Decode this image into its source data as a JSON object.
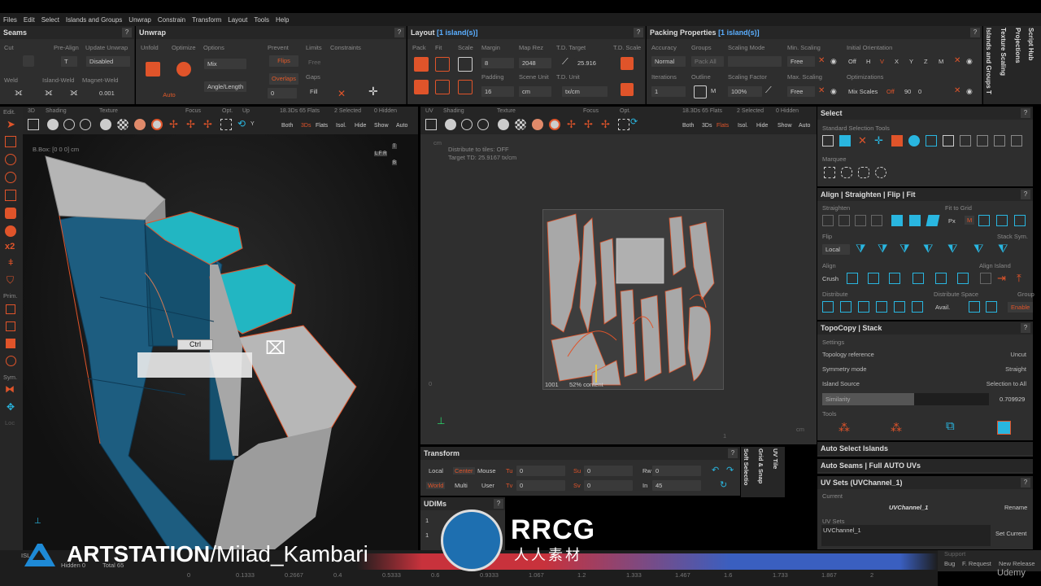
{
  "menu": [
    "Files",
    "Edit",
    "Select",
    "Islands and Groups",
    "Unwrap",
    "Constrain",
    "Transform",
    "Layout",
    "Tools",
    "Help"
  ],
  "seams": {
    "title": "Seams",
    "cut": "Cut",
    "pre_align": "Pre-Align",
    "update_unwrap": "Update Unwrap",
    "update_value": "Disabled",
    "weld": "Weld",
    "island_weld": "Island-Weld",
    "magnet_weld": "Magnet-Weld",
    "magnet_value": "0.001"
  },
  "unwrap": {
    "title": "Unwrap",
    "unfold": "Unfold",
    "optimize": "Optimize",
    "options": "Options",
    "mix": "Mix",
    "angle_length": "Angle/Length",
    "auto": "Auto",
    "prevent": "Prevent",
    "flips": "Flips",
    "overlaps": "Overlaps",
    "limits": "Limits",
    "free": "Free",
    "gaps": "Gaps",
    "fill": "Fill",
    "gaps_value": "0",
    "constraints": "Constraints"
  },
  "layout": {
    "title": "Layout",
    "title_sel": "[1 island(s)]",
    "pack": "Pack",
    "fit": "Fit",
    "scale": "Scale",
    "margin": "Margin",
    "margin_value": "8",
    "map_rez": "Map Rez",
    "map_rez_value": "2048",
    "td_target": "T.D. Target",
    "td_target_value": "25.916",
    "td_scale": "T.D. Scale",
    "padding": "Padding",
    "padding_value": "16",
    "scene_unit": "Scene Unit",
    "scene_unit_value": "cm",
    "td_unit": "T.D. Unit",
    "td_unit_value": "tx/cm"
  },
  "packing": {
    "title": "Packing Properties",
    "title_sel": "[1 island(s)]",
    "accuracy": "Accuracy",
    "accuracy_value": "Normal",
    "groups": "Groups",
    "pack_all": "Pack All",
    "scaling_mode": "Scaling Mode",
    "min_scaling": "Min. Scaling",
    "min_scaling_value": "Free",
    "initial_orientation": "Initial Orientation",
    "orientation_off": "Off",
    "orientation_h": "H",
    "orientation_v": "V",
    "axes": [
      "X",
      "Y",
      "Z",
      "M"
    ],
    "iterations": "Iterations",
    "iterations_value": "1",
    "outline": "Outline",
    "scaling_factor": "Scaling Factor",
    "scaling_factor_value": "100%",
    "max_scaling": "Max. Scaling",
    "max_scaling_value": "Free",
    "optimizations": "Optimizations",
    "mix_scales": "Mix Scales",
    "mix_off": "Off",
    "mix_90": "90",
    "mix_0": "0"
  },
  "side_tabs": [
    "Script Hub",
    "Projections",
    "Texture Scaling",
    "Islands and Groups T"
  ],
  "left_tools": {
    "edit": "Edit.",
    "prim": "Prim.",
    "sym": "Sym.",
    "loc": "Loc"
  },
  "vp3d": {
    "view": "3D",
    "shading": "Shading",
    "texture": "Texture",
    "focus": "Focus",
    "opt": "Opt.",
    "up": "Up",
    "axis": "Y",
    "stats": "18.3Ds 65 Flats",
    "selected": "2 Selected",
    "hidden": "0 Hidden",
    "both": "Both",
    "three_ds": "3Ds",
    "flats": "Flats",
    "isol": "Isol.",
    "hide": "Hide",
    "show": "Show",
    "auto": "Auto",
    "bbox": "B.Box: [0 0 0] cm",
    "ctrl": "Ctrl",
    "cube_top": "T",
    "cube_sides": "L F R",
    "cube_bottom": "B"
  },
  "vpuv": {
    "view": "UV",
    "shading": "Shading",
    "texture": "Texture",
    "focus": "Focus",
    "opt": "Opt.",
    "stats": "18.3Ds 65 Flats",
    "selected": "2 Selected",
    "hidden": "0 Hidden",
    "both": "Both",
    "three_ds": "3Ds",
    "flats": "Flats",
    "isol": "Isol.",
    "hide": "Hide",
    "show": "Show",
    "auto": "Auto",
    "info1": "Distribute to tiles: OFF",
    "info2": "Target TD: 25.9167 tx/cm",
    "cm_top": "cm",
    "cm_right": "cm",
    "tile": "1001",
    "content": "52% content",
    "axis0": "0",
    "axis1": "1"
  },
  "transform": {
    "title": "Transform",
    "local": "Local",
    "center": "Center",
    "mouse": "Mouse",
    "tu": "Tu",
    "tu_value": "0",
    "su": "Su",
    "su_value": "0",
    "rw": "Rw",
    "rw_value": "0",
    "world": "World",
    "multi": "Multi",
    "user": "User",
    "tv": "Tv",
    "tv_value": "0",
    "sv": "Sv",
    "sv_value": "0",
    "in": "In",
    "in_value": "45"
  },
  "uv_side_tabs": [
    "Soft Selectio",
    "Grid & Snap",
    "UV Tile"
  ],
  "udims": {
    "title": "UDIMs",
    "row1": "1",
    "row2": "1"
  },
  "select_panel": {
    "title": "Select",
    "std_tools": "Standard Selection Tools",
    "marquee": "Marquee"
  },
  "align_panel": {
    "title": "Align | Straighten | Flip | Fit",
    "straighten": "Straighten",
    "fit_to_grid": "Fit to Grid",
    "px": "Px",
    "m": "M",
    "flip": "Flip",
    "stack_sym": "Stack Sym.",
    "local": "Local",
    "align": "Align",
    "align_island": "Align Island",
    "crush": "Crush",
    "distribute": "Distribute",
    "distribute_space": "Distribute Space",
    "group": "Group",
    "avail": "Avail.",
    "enable": "Enable"
  },
  "topo_panel": {
    "title": "TopoCopy | Stack",
    "settings": "Settings",
    "topology_reference": "Topology reference",
    "topology_value": "Uncut",
    "symmetry_mode": "Symmetry mode",
    "symmetry_value": "Straight",
    "island_source": "Island Source",
    "island_source_value": "Selection to All",
    "similarity": "Similarity",
    "similarity_value": "0.709929",
    "similarity_level": 0.55,
    "tools": "Tools"
  },
  "auto_select": "Auto Select Islands",
  "auto_seams": "Auto Seams | Full AUTO UVs",
  "uv_sets": {
    "title": "UV Sets (UVChannel_1)",
    "current": "Current",
    "current_value": "UVChannel_1",
    "rename": "Rename",
    "uv_sets_label": "UV Sets",
    "set_value": "UVChannel_1",
    "set_current": "Set Current"
  },
  "support": {
    "label": "Support",
    "bug": "Bug",
    "request": "F. Request",
    "new_release": "New Release"
  },
  "status": {
    "hidden": "Hidden 0",
    "total": "Total 65",
    "isl": "ISL",
    "ruler": [
      "0",
      "0.1333",
      "0.2667",
      "0.4",
      "0.5333",
      "0.6",
      "0.9333",
      "1.067",
      "1.2",
      "1.333",
      "1.467",
      "1.6",
      "1.733",
      "1.867",
      "2"
    ]
  },
  "watermark": {
    "artstation": "ARTSTATION",
    "author": "/Milad_Kambari",
    "rrcg": "RRCG",
    "rrcg_cn": "人人素材",
    "udemy": "Udemy"
  },
  "colors": {
    "accent": "#e0542a",
    "teal": "#2ab4bf",
    "blue_mesh": "#1a5a7a"
  }
}
